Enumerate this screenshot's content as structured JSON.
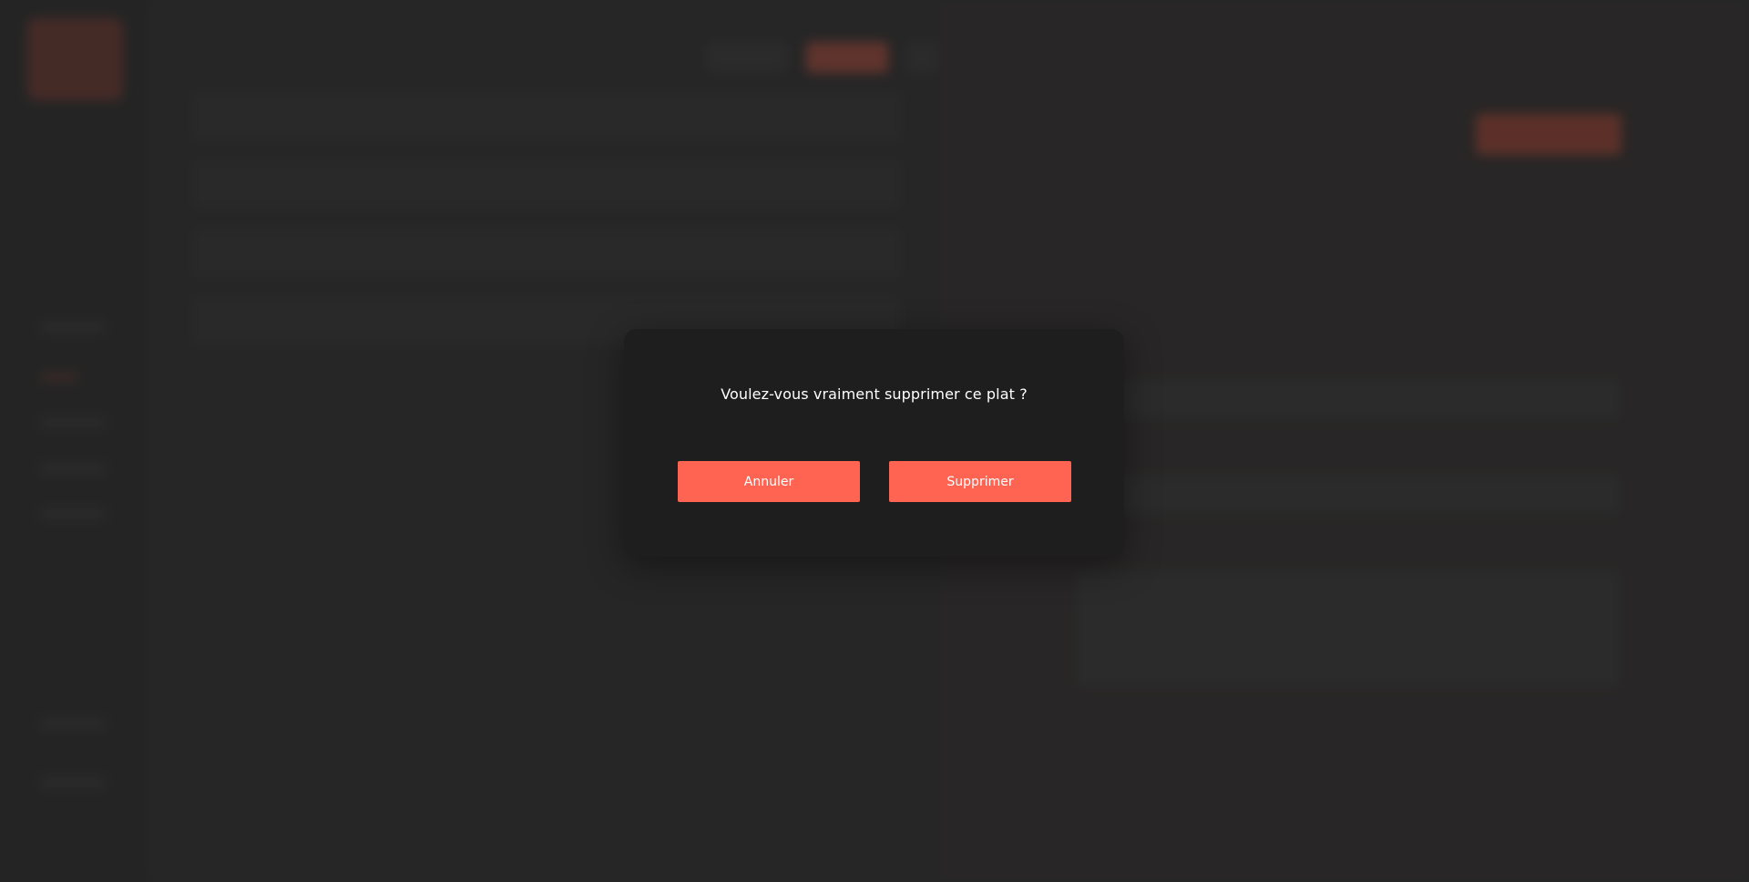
{
  "colors": {
    "accent": "#ff6351",
    "modal_bg": "#1e1e1e",
    "backdrop": "#2b2b2b"
  },
  "dialog": {
    "message": "Voulez-vous vraiment supprimer ce plat ?",
    "cancel_label": "Annuler",
    "delete_label": "Supprimer"
  }
}
